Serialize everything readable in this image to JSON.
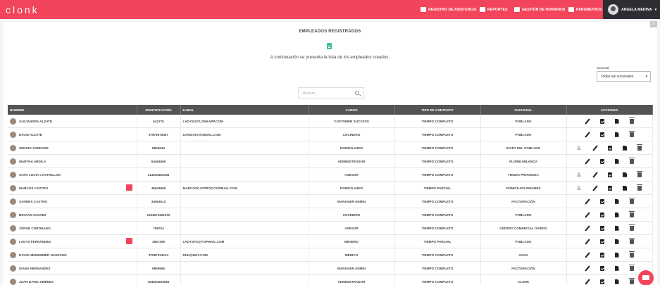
{
  "brand": {
    "logo": "clonk",
    "accent": "#f2445a",
    "dark": "#2d2d33"
  },
  "nav": [
    {
      "label": "REGISTRO DE ASISTENCIA",
      "icon": "camera-icon"
    },
    {
      "label": "REPORTES",
      "icon": "report-icon"
    },
    {
      "label": "GESTIÓN DE HORARIOS",
      "icon": "calendar-icon"
    },
    {
      "label": "PARÁMETROS",
      "icon": "gears-icon"
    }
  ],
  "user": {
    "name": "ANGELA MEDINA"
  },
  "page": {
    "title": "EMPLEADOS REGISTRADOS",
    "subtitle": "A continuación se presenta la lista de los empleados creados.",
    "close": "x"
  },
  "filter": {
    "label": "Sucursal",
    "value": "Todas las sucursales"
  },
  "search": {
    "placeholder": "Buscar..."
  },
  "table": {
    "headers": [
      "NOMBRE",
      "IDENTIFICACIÓN",
      "E-MAIL",
      "CARGO",
      "TIPO DE CONTRATO",
      "SUCURSAL",
      "ACCIONES"
    ],
    "rows": [
      {
        "name": "ALEJANDRA ALZATE",
        "id": "541275",
        "email": "LADYS@CLONKAPP.COM",
        "cargo": "CUSTOMER SUCCESS",
        "contrato": "TIEMPO COMPLETO",
        "sucursal": "POBLADO",
        "badge": false,
        "assign": false
      },
      {
        "name": "DAVID ALZATE",
        "id": "67878679467",
        "email": "DAVIDA07@GMAIL.COM",
        "cargo": "COCINERO",
        "contrato": "TIEMPO COMPLETO",
        "sucursal": "POBLADO",
        "badge": false,
        "assign": false
      },
      {
        "name": "SERGIO ANDRADE",
        "id": "8956644",
        "email": "",
        "cargo": "DOMICILIARIO",
        "contrato": "TIEMPO COMPLETO",
        "sucursal": "EXITO DEL POBLADO",
        "badge": false,
        "assign": true
      },
      {
        "name": "MARTHA ARDILA",
        "id": "64464566",
        "email": "",
        "cargo": "ADMINISTRADOR",
        "contrato": "TIEMPO COMPLETO",
        "sucursal": "FLORIDABLANCA",
        "badge": false,
        "assign": false
      },
      {
        "name": "SARA LUCÍA CASTRILLON",
        "id": "314564456346",
        "email": "",
        "cargo": "ASESOR",
        "contrato": "TIEMPO COMPLETO",
        "sucursal": "TIENDA PROVENZA",
        "badge": false,
        "assign": true
      },
      {
        "name": "MARCOS CASTRO",
        "id": "45644965",
        "email": "MARCOSCASTRO@YOPMAIL.COM",
        "cargo": "DOMICILIARIO",
        "contrato": "TIEMPO PARCIAL",
        "sucursal": "DOMICILIOS PINARES",
        "badge": true,
        "assign": true
      },
      {
        "name": "SANDRA CASTRO",
        "id": "34564513",
        "email": "",
        "cargo": "MANAGER ADMIN",
        "contrato": "TIEMPO COMPLETO",
        "sucursal": "FACTURACIÓN",
        "badge": false,
        "assign": false
      },
      {
        "name": "BRAYAN CHAVEZ",
        "id": "2344573321576",
        "email": "",
        "cargo": "COCINERO",
        "contrato": "TIEMPO COMPLETO",
        "sucursal": "POBLADO",
        "badge": false,
        "assign": false
      },
      {
        "name": "JORGE CORONADO",
        "id": "796754",
        "email": "",
        "cargo": "ASESOR",
        "contrato": "TIEMPO COMPLETO",
        "sucursal": "CENTRO COMERCIAL OVIEDO",
        "badge": false,
        "assign": false
      },
      {
        "name": "LADYS FERNÁNDEZ",
        "id": "3557399",
        "email": "LADYSFS@YOPMAIL.COM",
        "cargo": "MESERO",
        "contrato": "TIEMPO PARCIAL",
        "sucursal": "POBLADO",
        "badge": true,
        "assign": false
      },
      {
        "name": "DAVID HEINEMMER HANSSON",
        "id": "67987324134",
        "email": "DHH@HEY.COM",
        "cargo": "MEDICO",
        "contrato": "TIEMPO COMPLETO",
        "sucursal": "AVIVA",
        "badge": false,
        "assign": false
      },
      {
        "name": "DIANA HERNANDEZ",
        "id": "8965565",
        "email": "",
        "cargo": "MANAGER ADMIN",
        "contrato": "TIEMPO COMPLETO",
        "sucursal": "FACTURACIÓN",
        "badge": false,
        "assign": false
      },
      {
        "name": "JUAN DAVID JIMÉNEZ",
        "id": "464564364565",
        "email": "",
        "cargo": "ADMINISTRADOR",
        "contrato": "TIEMPO COMPLETO",
        "sucursal": "CLONK",
        "badge": false,
        "assign": false
      }
    ]
  }
}
